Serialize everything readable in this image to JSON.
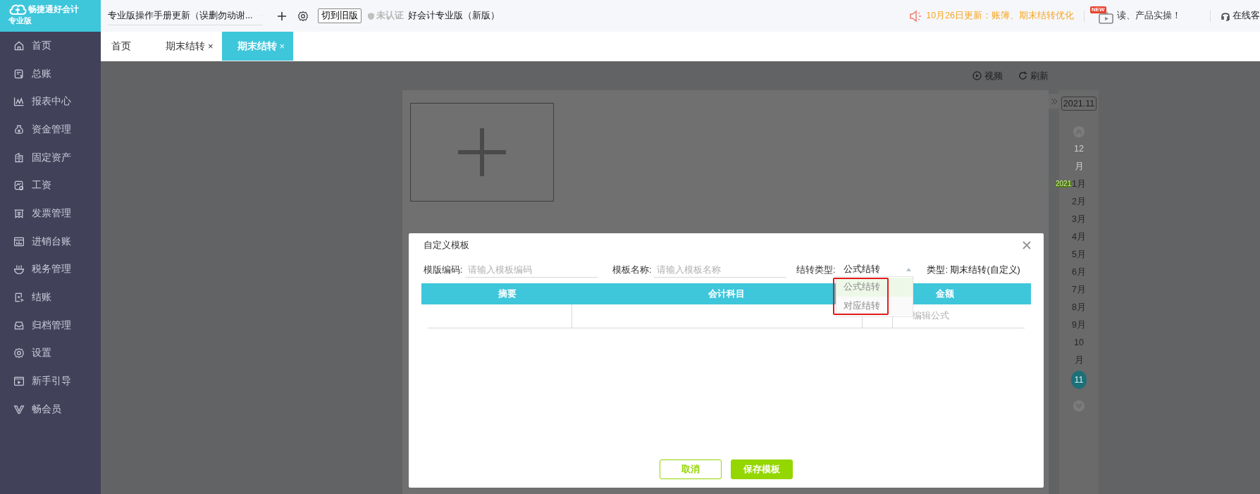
{
  "app": {
    "brand": "畅捷通好会计",
    "edition": "专业版"
  },
  "topbar": {
    "account": "专业版操作手册更新（误删勿动谢...",
    "switch_button": "切到旧版",
    "cert_status": "未认证",
    "product": "好会计专业版（新版）",
    "notice": "10月26日更新：账簿、期末结转优化",
    "promo_badge": "NEW",
    "promo": "读、产品实操！",
    "support": "在线客"
  },
  "sidebar": {
    "items": [
      {
        "label": "首页"
      },
      {
        "label": "总账"
      },
      {
        "label": "报表中心"
      },
      {
        "label": "资金管理"
      },
      {
        "label": "固定资产"
      },
      {
        "label": "工资"
      },
      {
        "label": "发票管理"
      },
      {
        "label": "进销台账"
      },
      {
        "label": "税务管理"
      },
      {
        "label": "结账"
      },
      {
        "label": "归档管理"
      },
      {
        "label": "设置"
      },
      {
        "label": "新手引导"
      },
      {
        "label": "畅会员"
      }
    ]
  },
  "tabs": [
    {
      "label": "首页",
      "selected": false
    },
    {
      "label": "期末结转",
      "close": "×",
      "selected": false
    },
    {
      "label": "期末结转",
      "close": "×",
      "selected": true
    }
  ],
  "toolbar": [
    {
      "label": "视频"
    },
    {
      "label": "刷新"
    }
  ],
  "calendar": {
    "period": "2021.11",
    "year_badge": "2021",
    "months": [
      {
        "label": "12月",
        "disabled": true,
        "selected": false
      },
      {
        "label": "1月",
        "disabled": false,
        "selected": false
      },
      {
        "label": "2月",
        "disabled": false,
        "selected": false
      },
      {
        "label": "3月",
        "disabled": false,
        "selected": false
      },
      {
        "label": "4月",
        "disabled": false,
        "selected": false
      },
      {
        "label": "5月",
        "disabled": false,
        "selected": false
      },
      {
        "label": "6月",
        "disabled": false,
        "selected": false
      },
      {
        "label": "7月",
        "disabled": false,
        "selected": false
      },
      {
        "label": "8月",
        "disabled": false,
        "selected": false
      },
      {
        "label": "9月",
        "disabled": false,
        "selected": false
      },
      {
        "label": "10月",
        "disabled": false,
        "selected": false
      },
      {
        "label": "11",
        "disabled": false,
        "selected": true
      }
    ]
  },
  "dialog": {
    "title": "自定义模板",
    "fields": [
      {
        "kind": "input",
        "label": "模版编码:",
        "placeholder": "请输入模板编码"
      },
      {
        "kind": "input",
        "label": "模板名称:",
        "placeholder": "请输入模板名称"
      },
      {
        "kind": "select",
        "label": "结转类型:",
        "value": "公式结转",
        "expanded": true
      }
    ],
    "type_label": "类型: 期末结转(自定义)",
    "dropdown": [
      {
        "label": "公式结转",
        "selected": true
      },
      {
        "label": "对应结转",
        "selected": false
      }
    ],
    "table": {
      "columns": [
        "摘要",
        "会计科目",
        "金额"
      ],
      "formula_placeholder": "编辑公式"
    },
    "buttons": [
      {
        "label": "取消",
        "kind": "secondary"
      },
      {
        "label": "保存模板",
        "kind": "primary"
      }
    ]
  }
}
